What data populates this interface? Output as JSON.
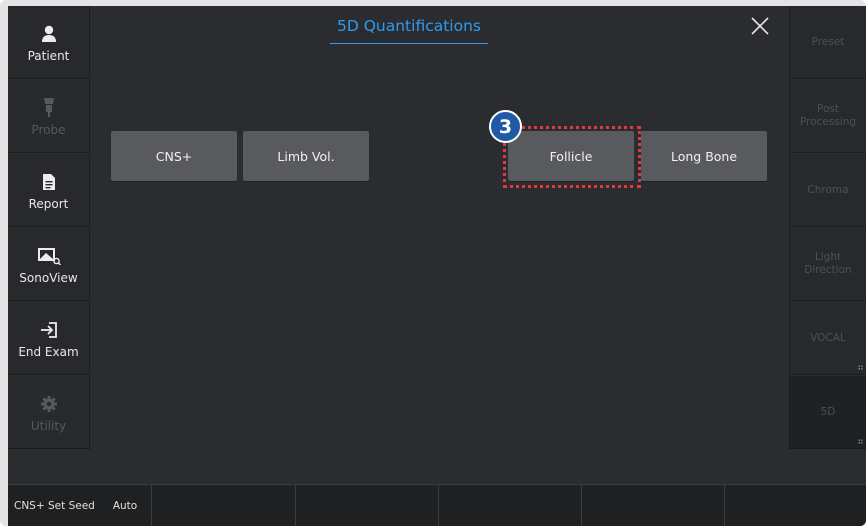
{
  "left_nav": [
    {
      "label": "Patient",
      "icon": "person-icon",
      "enabled": true
    },
    {
      "label": "Probe",
      "icon": "probe-icon",
      "enabled": false
    },
    {
      "label": "Report",
      "icon": "document-icon",
      "enabled": true
    },
    {
      "label": "SonoView",
      "icon": "sonoview-icon",
      "enabled": true
    },
    {
      "label": "End Exam",
      "icon": "exit-icon",
      "enabled": true
    },
    {
      "label": "Utility",
      "icon": "gear-icon",
      "enabled": false
    }
  ],
  "right_nav": [
    {
      "label": "Preset"
    },
    {
      "label": "Post Processing"
    },
    {
      "label": "Chroma"
    },
    {
      "label": "Light Direction"
    },
    {
      "label": "VOCAL"
    },
    {
      "label": "5D"
    }
  ],
  "dialog": {
    "title": "5D Quantifications",
    "close_icon": "close-icon"
  },
  "buttons": {
    "cns": "CNS+",
    "limb": "Limb Vol.",
    "follicle": "Follicle",
    "long_bone": "Long Bone"
  },
  "callout": {
    "number": "3",
    "color": "#e0393e",
    "badge_color": "#1f5aa5"
  },
  "bottom_bar": {
    "seed_label": "CNS+ Set Seed",
    "seed_value": "Auto"
  },
  "colors": {
    "accent": "#2e9bf0",
    "button_bg": "#585a5e",
    "panel_bg": "#2a2c2f"
  }
}
